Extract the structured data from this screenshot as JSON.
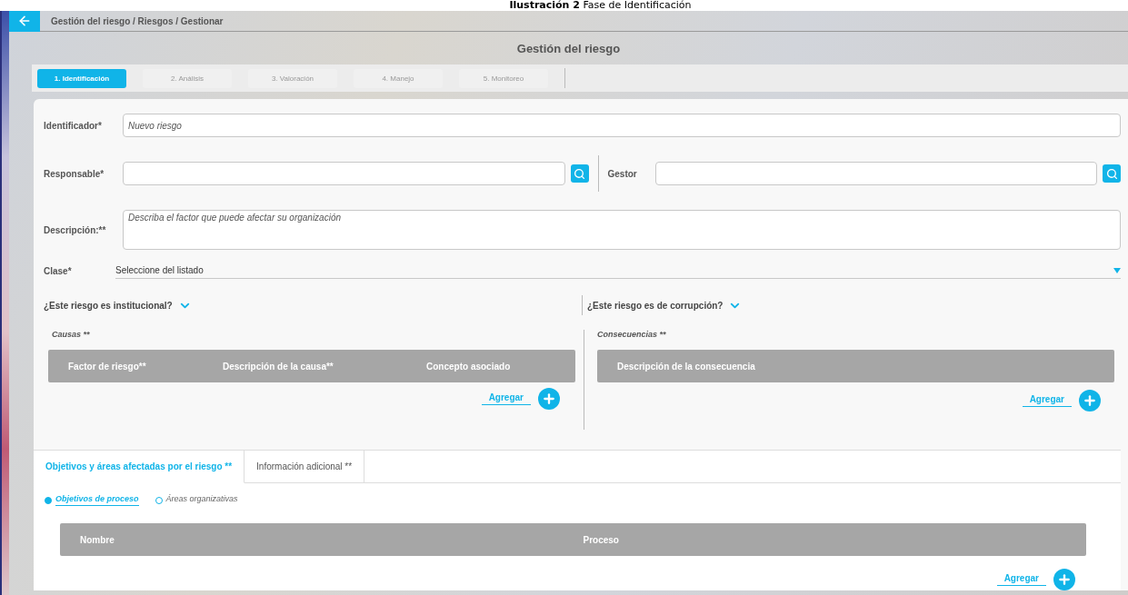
{
  "caption": "**Ilustración 2** Fase de Identificación",
  "breadcrumb": "Gestión del riesgo / Riesgos / Gestionar",
  "title": "Gestión del riesgo",
  "steps": [
    {
      "label": "1. Identificación",
      "selected": true
    },
    {
      "label": "2. Análisis",
      "selected": false
    },
    {
      "label": "3. Valoración",
      "selected": false
    },
    {
      "label": "4. Manejo",
      "selected": false
    },
    {
      "label": "5. Monitoreo",
      "selected": false
    }
  ],
  "identificador": {
    "label": "Identificador*",
    "placeholder": "Nuevo riesgo"
  },
  "responsable": {
    "label": "Responsable*"
  },
  "gestor": {
    "label": "Gestor"
  },
  "descripcion": {
    "label": "Descripción:**",
    "placeholder": "Describa el factor que puede afectar su organización"
  },
  "clase": {
    "label": "Clase*",
    "value": "Seleccione del listado"
  },
  "questions": [
    {
      "label": "¿Este riesgo es institucional?",
      "expanded": false
    },
    {
      "label": "¿Este riesgo es de corrupción?",
      "expanded": false
    }
  ],
  "causas": {
    "title": "Causas **",
    "columns": [
      "Factor de riesgo**",
      "Descripción de la causa**",
      "Concepto asociado"
    ],
    "add": "Agregar"
  },
  "consecuencias": {
    "title": "Consecuencias **",
    "columns": [
      "Descripción de la consecuencia"
    ],
    "add": "Agregar"
  },
  "bottom_tabs": [
    {
      "label": "Objetivos y áreas afectadas por el riesgo **",
      "selected": true
    },
    {
      "label": "Información adicional **",
      "selected": false
    }
  ],
  "radios": [
    {
      "label": "Objetivos de proceso",
      "selected": true
    },
    {
      "label": "Áreas organizativas",
      "selected": false
    }
  ],
  "objetivos_table": {
    "columns": [
      "Nombre",
      "Proceso"
    ],
    "add": "Agregar"
  }
}
